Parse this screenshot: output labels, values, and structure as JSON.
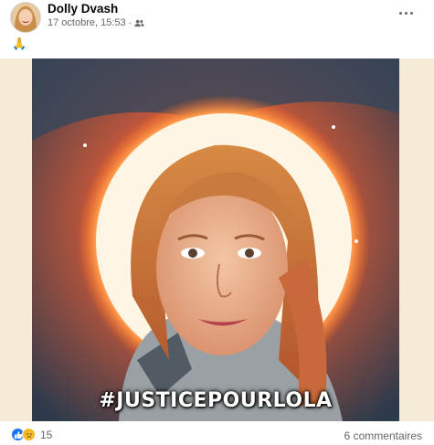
{
  "post": {
    "author": "Dolly Dvash",
    "timestamp": "17 octobre, 15:53",
    "separator": "·",
    "audience_icon": "friends-icon",
    "text": "🙏",
    "more_icon": "more-options-icon"
  },
  "media": {
    "caption": "#JUSTICEPOURLOLA"
  },
  "footer": {
    "reaction_icons": [
      "like-icon",
      "sad-icon"
    ],
    "reaction_count": "15",
    "comments": "6 commentaires"
  },
  "colors": {
    "like": "#1877f2",
    "sad": "#f7b928",
    "meta_text": "#65676b",
    "media_background": "#f5ebd7"
  }
}
